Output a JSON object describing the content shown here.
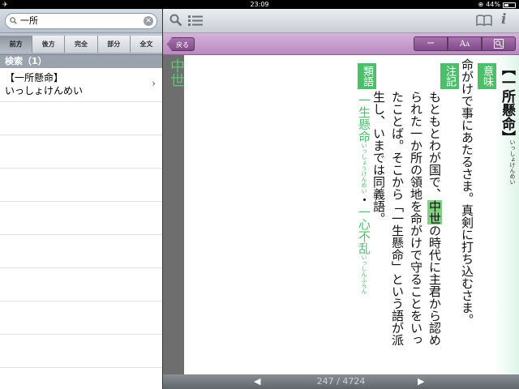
{
  "status": {
    "time": "23:09",
    "battery": "44%",
    "battery_level": 0.44
  },
  "search": {
    "value": "一所",
    "clear_icon": "clear-icon"
  },
  "segments": [
    "前方",
    "後方",
    "完全",
    "部分",
    "全文"
  ],
  "active_segment": 0,
  "results_header": "検索（1）",
  "results": [
    {
      "headword": "【一所懸命】",
      "reading": "いっしょけんめい"
    }
  ],
  "reader": {
    "back_label": "戻る",
    "btn_minus": "ー",
    "btn_font": "AA",
    "btn_zoom": "Q",
    "side_word": "中世",
    "headword": "【一所懸命】",
    "headword_reading": "いっしょけんめい",
    "label_meaning": "意味",
    "meaning_text": "命がけで事にあたるさま。真剣に打ち込むさま。",
    "label_note": "注記",
    "note_text_1": "もともとわが国で、",
    "note_highlight": "中世",
    "note_text_2": "の時代に主君から認められた一か所の領地を命がけで守ることをいったことば。そこから「一生懸命」という語が派生し、いまでは同義語。",
    "label_related": "類語",
    "related_1": "一生懸命",
    "related_1_reading": "いっしょうけんめい",
    "related_sep": "・",
    "related_2": "一心不乱",
    "related_2_reading": "いっしんふらん"
  },
  "pager": {
    "current": "247",
    "total": "4724",
    "sep": "/",
    "prev": "◀",
    "next": "▶"
  }
}
